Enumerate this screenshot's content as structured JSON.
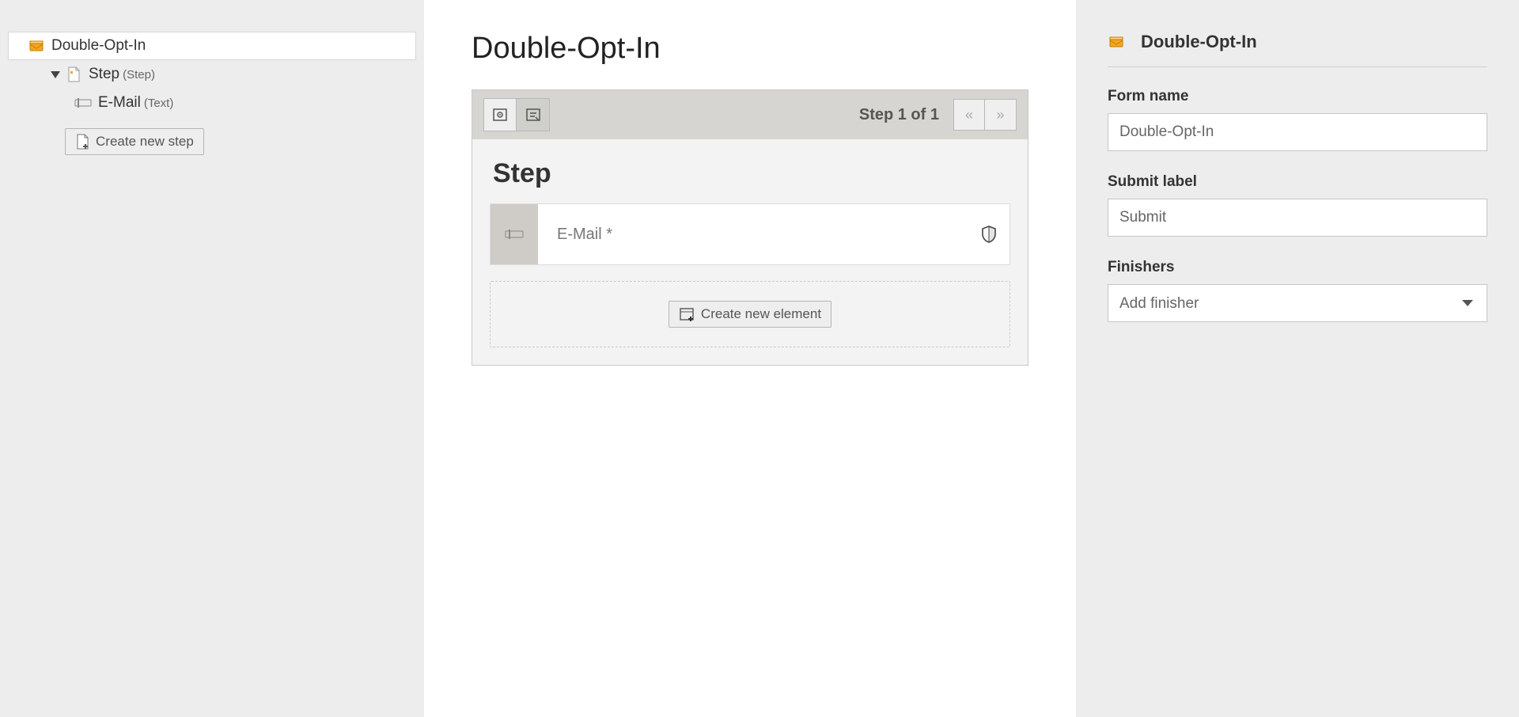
{
  "tree": {
    "root": {
      "label": "Double-Opt-In"
    },
    "step": {
      "label": "Step",
      "type_hint": "(Step)"
    },
    "field": {
      "label": "E-Mail",
      "type_hint": "(Text)"
    },
    "create_step_btn": "Create new step"
  },
  "center": {
    "page_title": "Double-Opt-In",
    "step_indicator": "Step 1 of 1",
    "step_heading": "Step",
    "field_label": "E-Mail *",
    "create_element_btn": "Create new element"
  },
  "inspector": {
    "title": "Double-Opt-In",
    "form_name_label": "Form name",
    "form_name_value": "Double-Opt-In",
    "submit_label_label": "Submit label",
    "submit_label_value": "Submit",
    "finishers_label": "Finishers",
    "finishers_placeholder": "Add finisher"
  },
  "icons": {
    "form": "form-icon",
    "page": "page-icon",
    "text_field": "text-field-icon",
    "shield": "shield-icon"
  }
}
